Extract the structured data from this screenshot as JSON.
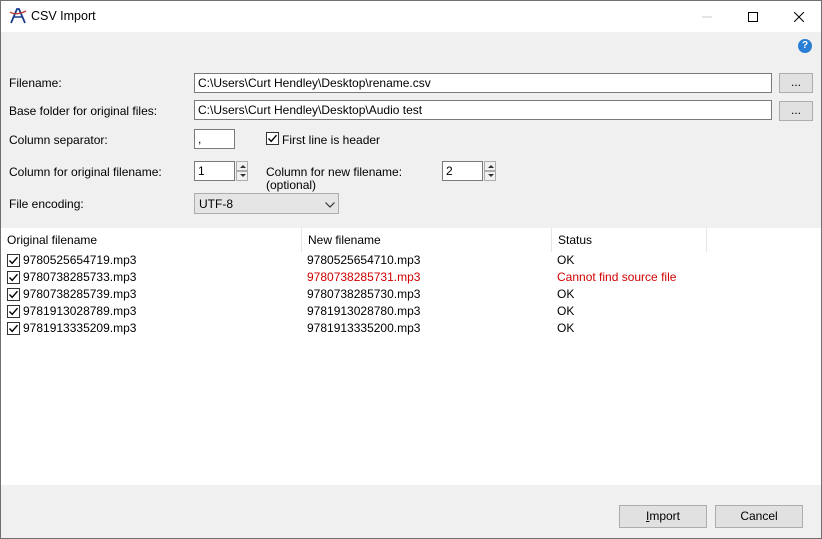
{
  "window": {
    "title": "CSV Import",
    "help_icon": "?",
    "controls": {
      "minimize": "minimize-icon",
      "maximize": "maximize-icon",
      "close": "close-icon"
    }
  },
  "form": {
    "filename_label": "Filename:",
    "filename_value": "C:\\Users\\Curt Hendley\\Desktop\\rename.csv",
    "base_folder_label": "Base folder for original files:",
    "base_folder_value": "C:\\Users\\Curt Hendley\\Desktop\\Audio test",
    "browse_label": "...",
    "column_separator_label": "Column separator:",
    "column_separator_value": ",",
    "first_line_header_label": "First line is header",
    "first_line_header_checked": true,
    "column_original_label": "Column for original filename:",
    "column_original_value": "1",
    "column_new_label": "Column for new filename:",
    "column_new_optional": "(optional)",
    "column_new_value": "2",
    "file_encoding_label": "File encoding:",
    "file_encoding_value": "UTF-8"
  },
  "list": {
    "columns": [
      "Original filename",
      "New filename",
      "Status"
    ],
    "rows": [
      {
        "checked": true,
        "original": "9780525654719.mp3",
        "new": "9780525654710.mp3",
        "status": "OK",
        "error": false
      },
      {
        "checked": true,
        "original": "9780738285733.mp3",
        "new": "9780738285731.mp3",
        "status": "Cannot find source file",
        "error": true
      },
      {
        "checked": true,
        "original": "9780738285739.mp3",
        "new": "9780738285730.mp3",
        "status": "OK",
        "error": false
      },
      {
        "checked": true,
        "original": "9781913028789.mp3",
        "new": "9781913028780.mp3",
        "status": "OK",
        "error": false
      },
      {
        "checked": true,
        "original": "9781913335209.mp3",
        "new": "9781913335200.mp3",
        "status": "OK",
        "error": false
      }
    ]
  },
  "buttons": {
    "import": "Import",
    "cancel": "Cancel"
  },
  "colors": {
    "error": "#d00000",
    "help": "#2a7fd4"
  }
}
